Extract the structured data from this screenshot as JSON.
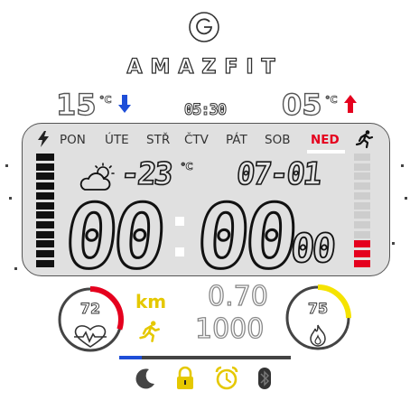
{
  "brand": {
    "name": "AMAZFIT",
    "logo_icon": "amazfit-logo-icon"
  },
  "weather_top": {
    "temp_low": "15",
    "temp_low_unit": "°C",
    "temp_high": "05",
    "temp_high_unit": "°C",
    "sunrise": "05:30",
    "low_arrow_color": "#1e4ed8",
    "high_arrow_color": "#e5001e"
  },
  "days": {
    "items": [
      "PON",
      "ÚTE",
      "STŘ",
      "ČTV",
      "PÁT",
      "SOB",
      "NED"
    ],
    "active_index": 6,
    "active_color": "#e5001e"
  },
  "weather": {
    "icon": "partly-cloudy-icon",
    "temperature": "-23",
    "unit": "°C"
  },
  "date": "07-01",
  "time": {
    "hours": "00",
    "minutes": "00",
    "seconds": "00"
  },
  "battery_bar": {
    "segments_total": 12,
    "segments_filled": 12,
    "color": "#111111"
  },
  "steps_bar": {
    "segments_total": 12,
    "segments_filled": 3,
    "fill_color": "#e5001e"
  },
  "heart_rate": {
    "value": "72",
    "icon": "heart-rate-icon",
    "ring_color": "#e5001e",
    "ring_fraction": 0.3
  },
  "calories": {
    "value": "75",
    "icon": "flame-icon",
    "ring_color": "#f5e300",
    "ring_fraction": 0.25
  },
  "distance": {
    "unit": "km",
    "value": "0.70",
    "goal": "1000",
    "runner_icon": "running-icon"
  },
  "progress": {
    "fraction": 0.13,
    "color": "#1e4ed8"
  },
  "status_icons": [
    {
      "name": "moon-icon",
      "color": "#444444"
    },
    {
      "name": "lock-icon",
      "color": "#e5c800"
    },
    {
      "name": "alarm-icon",
      "color": "#e5c800"
    },
    {
      "name": "bluetooth-icon",
      "color": "#333333"
    }
  ]
}
